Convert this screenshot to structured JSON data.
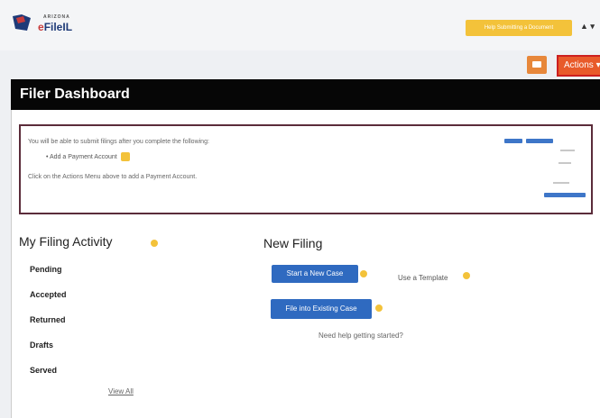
{
  "header": {
    "logo_small": "ARIZONA",
    "logo_name_prefix": "e",
    "logo_name": "FileIL",
    "banner_text": "Help Submitting a Document",
    "user_menu": "▲ ▾",
    "actions_button": "Actions ▾"
  },
  "dashboard": {
    "title": "Filer Dashboard"
  },
  "notice": {
    "line1": "You will be able to submit filings after you complete the following:",
    "line2": "• Add a Payment Account",
    "line3": "Click on the Actions Menu above to add a Payment Account."
  },
  "filing_activity": {
    "title": "My Filing Activity",
    "items": [
      "Pending",
      "Accepted",
      "Returned",
      "Drafts",
      "Served"
    ],
    "view_all": "View All"
  },
  "new_filing": {
    "title": "New Filing",
    "start_case": "Start a New Case",
    "use_template": "Use a Template",
    "file_existing": "File into Existing Case",
    "help_link": "Need help getting started?"
  },
  "colors": {
    "brand_blue": "#2f6ac0",
    "accent_orange": "#e85a2a",
    "banner_yellow": "#f3c23a",
    "header_black": "#060606"
  }
}
